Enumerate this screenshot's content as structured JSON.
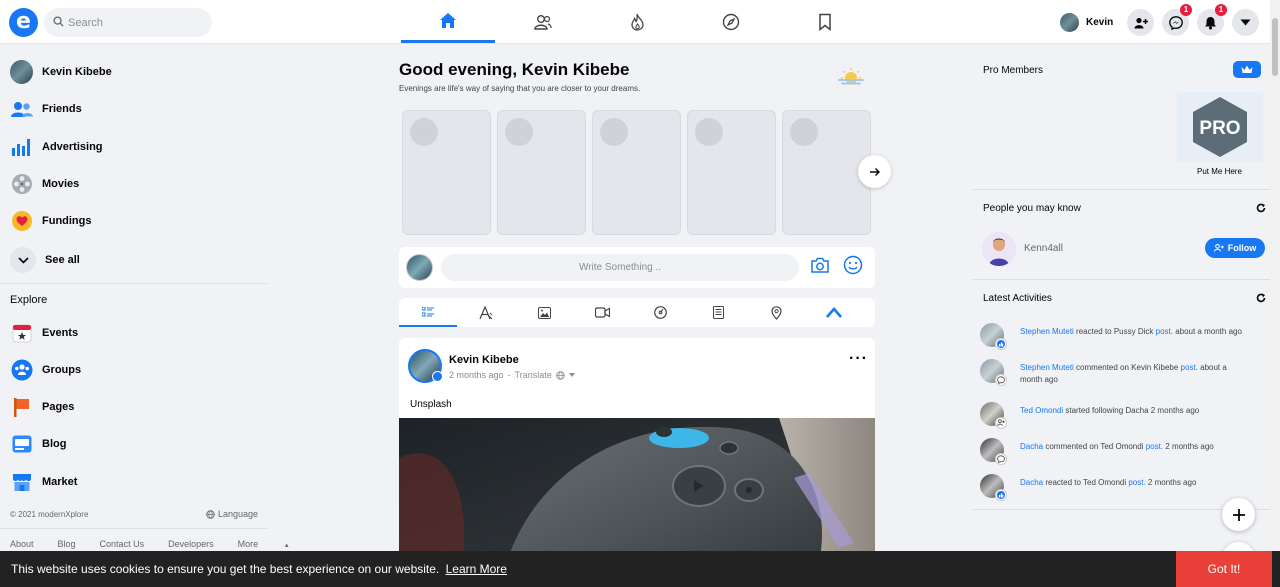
{
  "header": {
    "logo_letter": "e",
    "search_placeholder": "Search",
    "user_name": "Kevin",
    "messenger_badge": "1",
    "notifications_badge": "1"
  },
  "sidebar": {
    "profile_name": "Kevin Kibebe",
    "items": [
      {
        "label": "Friends",
        "icon": "friends-icon"
      },
      {
        "label": "Advertising",
        "icon": "advertising-icon"
      },
      {
        "label": "Movies",
        "icon": "movies-icon"
      },
      {
        "label": "Fundings",
        "icon": "fundings-icon"
      }
    ],
    "see_all": "See all",
    "explore_heading": "Explore",
    "explore_items": [
      {
        "label": "Events",
        "icon": "events-icon"
      },
      {
        "label": "Groups",
        "icon": "groups-icon"
      },
      {
        "label": "Pages",
        "icon": "pages-icon"
      },
      {
        "label": "Blog",
        "icon": "blog-icon"
      },
      {
        "label": "Market",
        "icon": "market-icon"
      }
    ],
    "copyright": "© 2021 modernXplore",
    "language": "Language",
    "footer_links": [
      "About",
      "Blog",
      "Contact Us",
      "Developers",
      "More"
    ]
  },
  "main": {
    "greeting": "Good evening, Kevin Kibebe",
    "greeting_sub": "Evenings are life's way of saying that you are closer to your dreams.",
    "composer_placeholder": "Write Something ..",
    "post": {
      "author": "Kevin Kibebe",
      "time": "2 months ago",
      "separator": "-",
      "translate": "Translate",
      "text": "Unsplash"
    }
  },
  "right": {
    "pro_heading": "Pro Members",
    "pro_badge": "PRO",
    "pro_caption": "Put Me Here",
    "people_heading": "People you may know",
    "person_name": "Kenn4all",
    "follow_label": "Follow",
    "activities_heading": "Latest Activities",
    "activities": [
      {
        "actor": "Stephen Muteti",
        "mid": " reacted to Pussy Dick ",
        "link": "post.",
        "tail": " about a month ago"
      },
      {
        "actor": "Stephen Muteti",
        "mid": " commented on Kevin Kibebe ",
        "link": "post.",
        "tail": " about a month ago"
      },
      {
        "actor": "Ted Omondi",
        "mid": " started following Dacha 2 months ago",
        "link": "",
        "tail": ""
      },
      {
        "actor": "Dacha",
        "mid": " commented on Ted Omondi ",
        "link": "post.",
        "tail": " 2 months ago"
      },
      {
        "actor": "Dacha",
        "mid": " reacted to Ted Omondi ",
        "link": "post.",
        "tail": " 2 months ago"
      }
    ]
  },
  "cookie": {
    "message": "This website uses cookies to ensure you get the best experience on our website.",
    "learn_more": "Learn More",
    "got_it": "Got It!"
  },
  "colors": {
    "accent": "#1877f2",
    "cookie_button": "#e9413a",
    "badge": "#e41e3f"
  }
}
